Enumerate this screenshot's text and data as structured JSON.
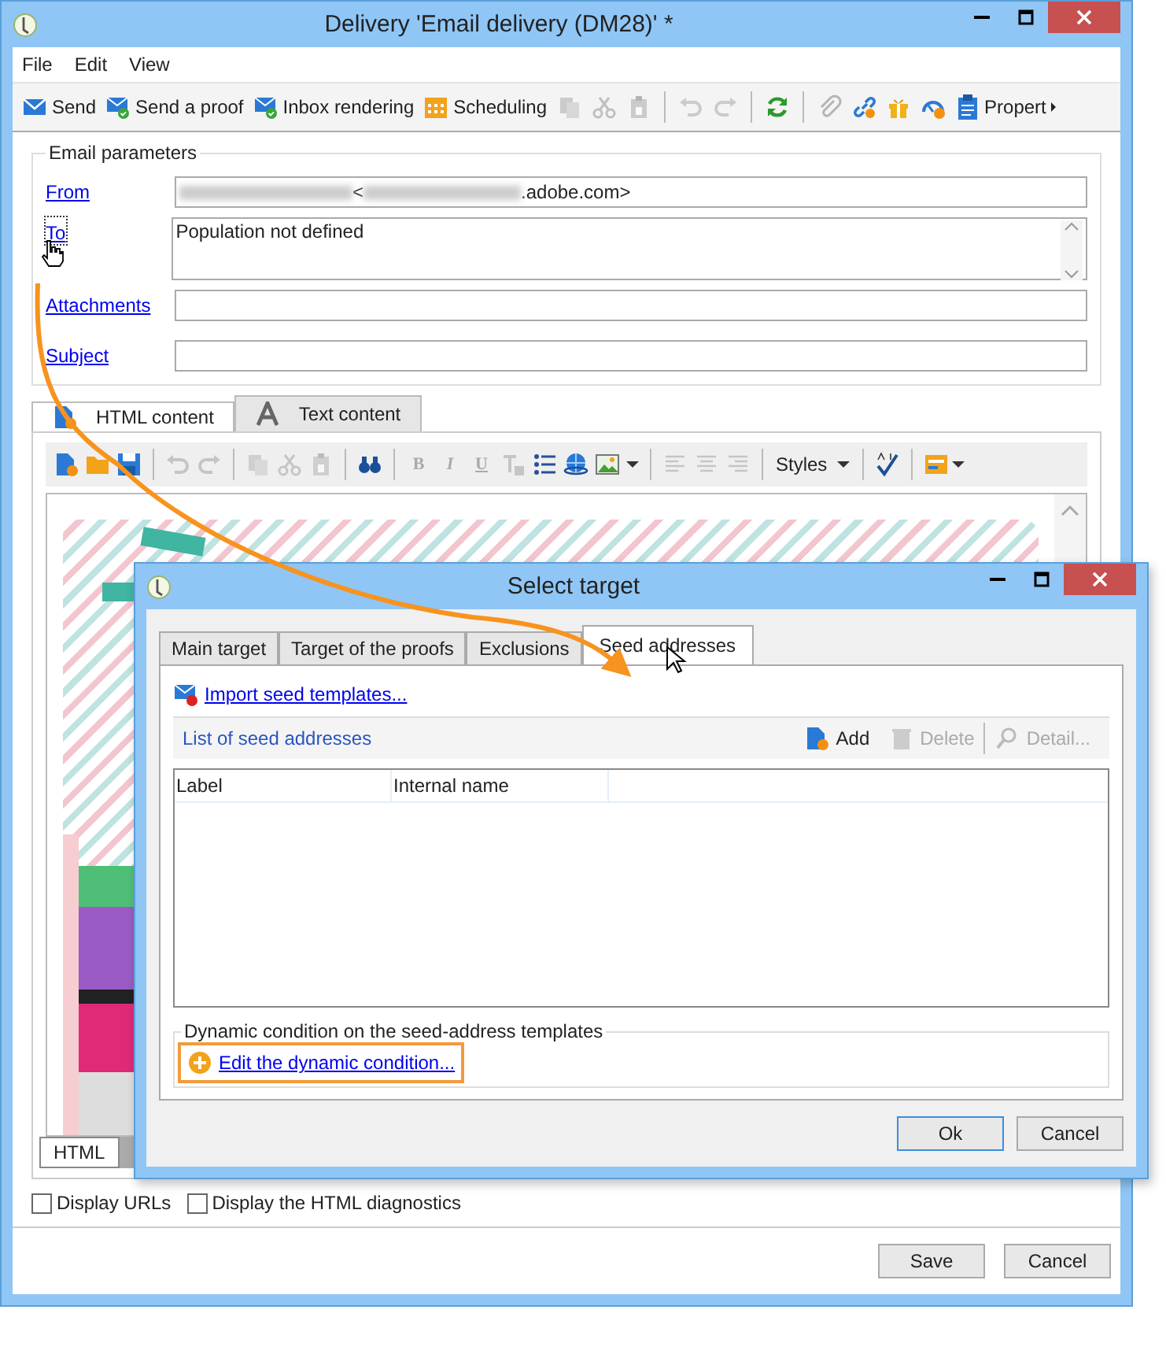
{
  "window": {
    "title": "Delivery 'Email delivery (DM28)' *"
  },
  "menu": [
    "File",
    "Edit",
    "View"
  ],
  "toolbar": [
    {
      "kind": "text",
      "label": "Send",
      "disabled": false
    },
    {
      "kind": "text",
      "label": "Send a proof",
      "disabled": false
    },
    {
      "kind": "text",
      "label": "Inbox rendering",
      "disabled": false
    },
    {
      "kind": "text",
      "label": "Scheduling",
      "disabled": false
    },
    {
      "kind": "icon",
      "disabled": true
    },
    {
      "kind": "icon",
      "disabled": true
    },
    {
      "kind": "icon",
      "disabled": true
    },
    {
      "kind": "sep"
    },
    {
      "kind": "icon",
      "disabled": true
    },
    {
      "kind": "icon",
      "disabled": true
    },
    {
      "kind": "sep"
    },
    {
      "kind": "icon",
      "disabled": false
    },
    {
      "kind": "sep"
    },
    {
      "kind": "icon",
      "disabled": true
    },
    {
      "kind": "icon",
      "disabled": false
    },
    {
      "kind": "icon",
      "disabled": false
    },
    {
      "kind": "icon",
      "disabled": false
    },
    {
      "kind": "more",
      "label": "Propert",
      "disabled": false
    }
  ],
  "email_parameters": {
    "title": "Email parameters",
    "fields": [
      {
        "kind": "from",
        "label": "From",
        "value_start": "<",
        "value_end": ".adobe.com>",
        "focused": false
      },
      {
        "kind": "multiline",
        "label": "To",
        "value": "Population not defined",
        "focused": true
      },
      {
        "kind": "single",
        "label": "Attachments",
        "focused": false
      },
      {
        "kind": "single",
        "label": "Subject",
        "focused": false
      }
    ]
  },
  "content_tabs": [
    {
      "label": "HTML content",
      "selected": true
    },
    {
      "label": "Text content",
      "selected": false
    }
  ],
  "editor_toolbar": [
    {
      "kind": "icon",
      "disabled": false
    },
    {
      "kind": "icon",
      "disabled": false
    },
    {
      "kind": "icon",
      "disabled": false
    },
    {
      "kind": "sep"
    },
    {
      "kind": "icon",
      "disabled": true
    },
    {
      "kind": "icon",
      "disabled": true
    },
    {
      "kind": "sep"
    },
    {
      "kind": "icon",
      "disabled": true
    },
    {
      "kind": "icon",
      "disabled": true
    },
    {
      "kind": "icon",
      "disabled": true
    },
    {
      "kind": "sep"
    },
    {
      "kind": "icon",
      "disabled": false
    },
    {
      "kind": "sep"
    },
    {
      "kind": "letter",
      "label": "B",
      "disabled": true
    },
    {
      "kind": "letter",
      "label": "I",
      "disabled": true
    },
    {
      "kind": "letter",
      "label": "U",
      "disabled": true
    },
    {
      "kind": "icon",
      "disabled": true
    },
    {
      "kind": "icon",
      "disabled": false
    },
    {
      "kind": "icon",
      "disabled": false
    },
    {
      "kind": "icon",
      "disabled": false
    },
    {
      "kind": "sep"
    },
    {
      "kind": "icon",
      "disabled": true
    },
    {
      "kind": "icon",
      "disabled": true
    },
    {
      "kind": "icon",
      "disabled": true
    },
    {
      "kind": "sep"
    },
    {
      "kind": "dropdown",
      "label": "Styles",
      "disabled": false
    },
    {
      "kind": "sep"
    },
    {
      "kind": "icon",
      "disabled": false
    },
    {
      "kind": "sep"
    },
    {
      "kind": "icon",
      "disabled": false
    }
  ],
  "bottom_tabs": [
    {
      "label": "HTML",
      "selected": true
    }
  ],
  "checkboxes": [
    {
      "label": "Display URLs",
      "checked": false
    },
    {
      "label": "Display the HTML diagnostics",
      "checked": false
    }
  ],
  "buttons": [
    "Save",
    "Cancel"
  ],
  "dialog": {
    "title": "Select target",
    "tabs": [
      {
        "label": "Main target",
        "selected": false
      },
      {
        "label": "Target of the proofs",
        "selected": false
      },
      {
        "label": "Exclusions",
        "selected": false
      },
      {
        "label": "Seed addresses",
        "selected": true
      }
    ],
    "import_link": "Import seed templates...",
    "list": {
      "title": "List of seed addresses",
      "actions": [
        {
          "label": "Add",
          "disabled": false
        },
        {
          "label": "Delete",
          "disabled": true
        },
        {
          "label": "Detail...",
          "disabled": true
        }
      ],
      "columns": [
        "Label",
        "Internal name"
      ]
    },
    "condition": {
      "title": "Dynamic condition on the seed-address templates",
      "link": "Edit the dynamic condition...",
      "highlighted": true
    },
    "buttons": [
      {
        "label": "Ok",
        "default": true
      },
      {
        "label": "Cancel",
        "default": false
      }
    ]
  }
}
